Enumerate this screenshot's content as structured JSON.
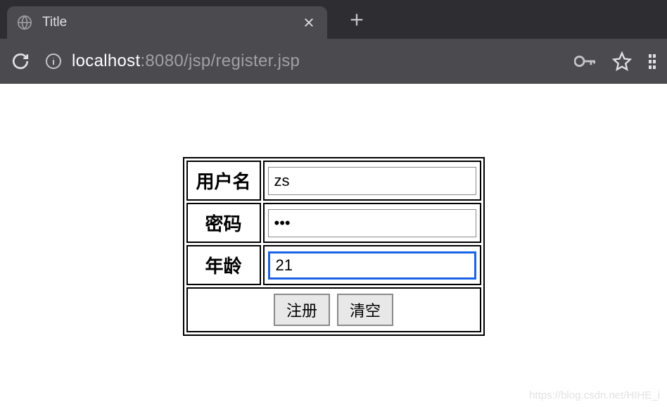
{
  "browser": {
    "tab_title": "Title",
    "url_host": "localhost",
    "url_port_path": ":8080/jsp/register.jsp"
  },
  "form": {
    "rows": [
      {
        "label": "用户名",
        "value": "zs",
        "type": "text",
        "name": "username"
      },
      {
        "label": "密码",
        "value": "123",
        "type": "password",
        "name": "password"
      },
      {
        "label": "年龄",
        "value": "21",
        "type": "text",
        "name": "age",
        "focused": true
      }
    ],
    "buttons": {
      "submit": "注册",
      "reset": "清空"
    }
  },
  "watermark": "https://blog.csdn.net/HIHE_i"
}
